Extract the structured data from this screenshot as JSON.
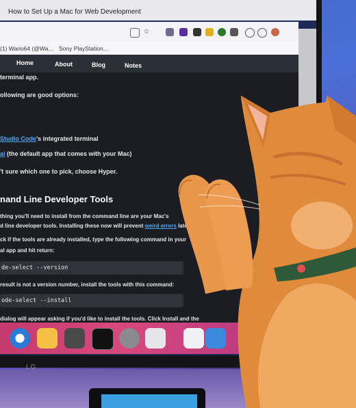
{
  "browser": {
    "window_title": "How to Set Up a Mac for Web Development",
    "bookmarks": [
      {
        "label": "(1) Wario64 (@Wa..."
      },
      {
        "label": "Sony PlayStation..."
      }
    ]
  },
  "site_nav": {
    "items": [
      {
        "label": "Home"
      },
      {
        "label": "About"
      },
      {
        "label": "Blog"
      },
      {
        "label": "Notes"
      }
    ]
  },
  "article": {
    "line1": "terminal app.",
    "line2": "ollowing are good options:",
    "line3_link": "Studio Code",
    "line3_rest": "'s integrated terminal",
    "line4_link": "al",
    "line4_rest": " (the default app that comes with your Mac)",
    "line5": "'t sure which one to pick, choose Hyper.",
    "heading": "nand Line Developer Tools",
    "para1_a": "thing you'll need to install from the command line are your Mac's",
    "para1_b_pre": "d line developer tools. Installing these now will prevent ",
    "para1_b_link": "weird errors",
    "para1_b_post": " later.",
    "para2_a": "ck if the tools are already installed, type the following command in your",
    "para2_b": "al app and hit return:",
    "code1": "de-select --version",
    "para3": "result is not a version number, install the tools with this command:",
    "code2": "ode-select --install",
    "para4": "dialog will appear asking if you'd like to install the tools. Click Install and the"
  },
  "monitor": {
    "brand": "LG"
  },
  "colors": {
    "dock": "#d9487c",
    "site_dark": "#1b1d22",
    "link": "#4aa7ff",
    "cat_fur": "#e08a3c",
    "collar": "#2f5a3a"
  },
  "icons": [
    "safari-icon",
    "sketch-icon",
    "sublime-icon",
    "terminal-icon",
    "system-preferences-icon",
    "launchpad-icon",
    "folder-icon"
  ]
}
